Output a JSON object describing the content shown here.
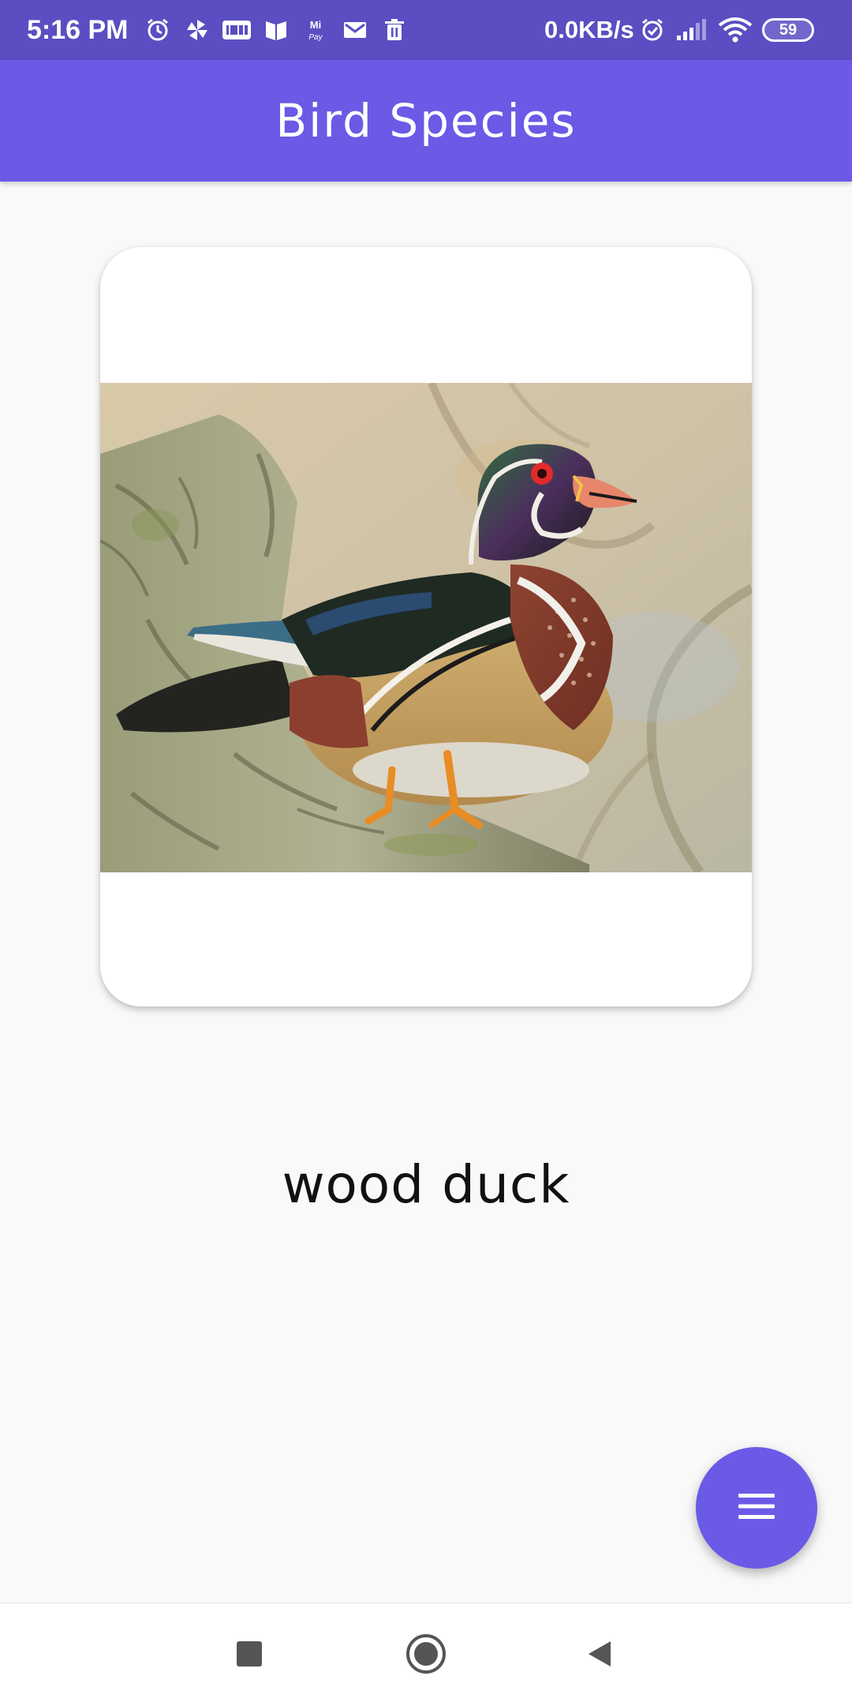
{
  "status_bar": {
    "time": "5:16 PM",
    "network_speed": "0.0KB/s",
    "battery_level": "59",
    "icons_left": [
      "alarm-icon",
      "pinwheel-icon",
      "imdb-icon",
      "book-icon",
      "mi-pay-icon",
      "mail-icon",
      "trash-icon"
    ],
    "icons_right": [
      "alarm-icon",
      "signal-icon",
      "wifi-icon",
      "battery-icon"
    ]
  },
  "app_bar": {
    "title": "Bird Species"
  },
  "card": {
    "image_subject": "wood duck photo"
  },
  "species": {
    "name": "wood duck"
  },
  "fab": {
    "icon": "menu-icon"
  },
  "nav_bar": {
    "buttons": [
      "recents-button",
      "home-button",
      "back-button"
    ]
  },
  "colors": {
    "status_bar": "#5a4ec2",
    "app_bar": "#6a5ae6",
    "fab": "#6a5ae6",
    "background": "#f9f9f9"
  }
}
